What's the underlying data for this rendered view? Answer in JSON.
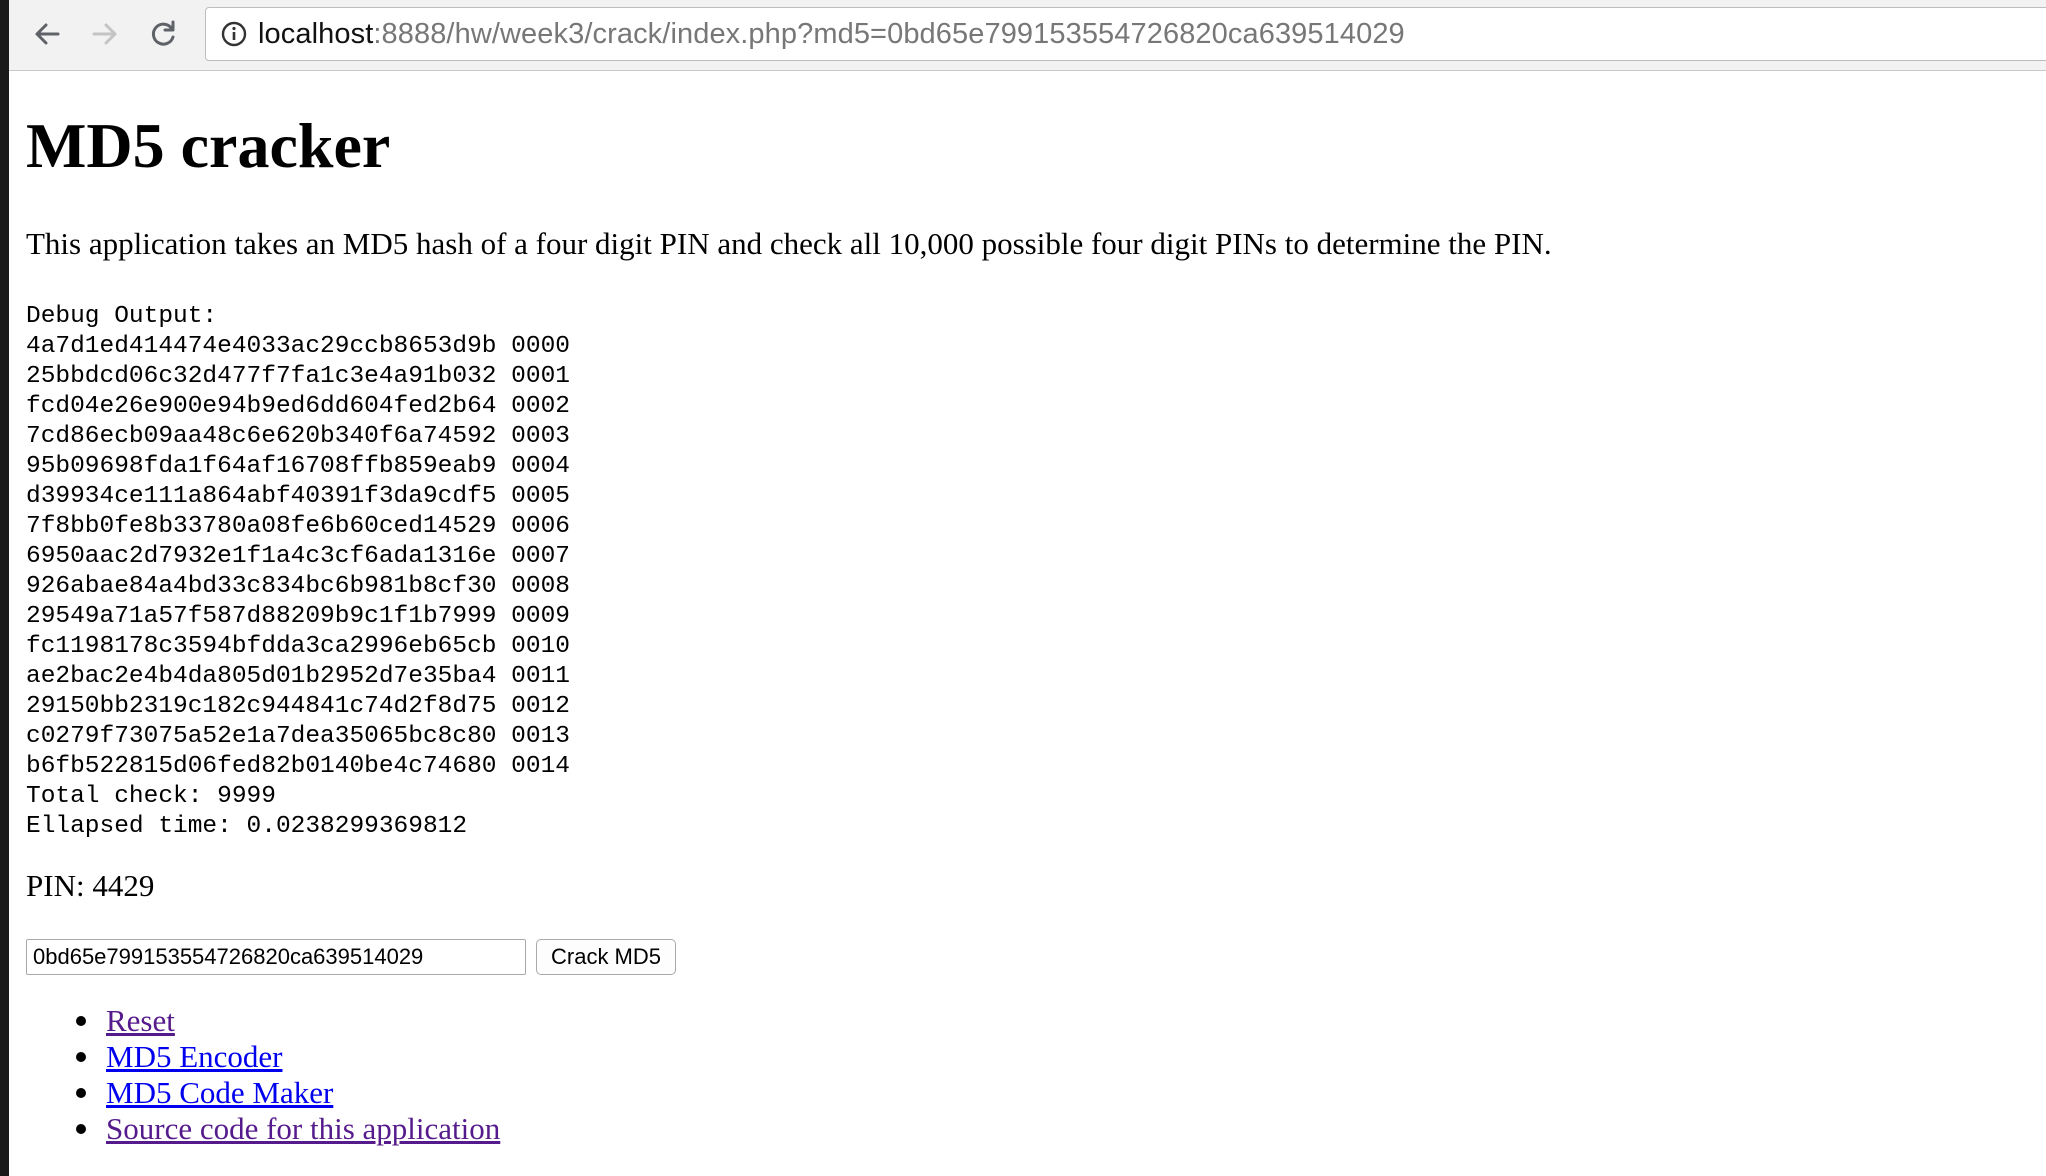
{
  "browser": {
    "url_host": "localhost",
    "url_rest": ":8888/hw/week3/crack/index.php?md5=0bd65e799153554726820ca639514029"
  },
  "page": {
    "title": "MD5 cracker",
    "description": "This application takes an MD5 hash of a four digit PIN and check all 10,000 possible four digit PINs to determine the PIN.",
    "debug_lines": [
      "Debug Output:",
      "4a7d1ed414474e4033ac29ccb8653d9b 0000",
      "25bbdcd06c32d477f7fa1c3e4a91b032 0001",
      "fcd04e26e900e94b9ed6dd604fed2b64 0002",
      "7cd86ecb09aa48c6e620b340f6a74592 0003",
      "95b09698fda1f64af16708ffb859eab9 0004",
      "d39934ce111a864abf40391f3da9cdf5 0005",
      "7f8bb0fe8b33780a08fe6b60ced14529 0006",
      "6950aac2d7932e1f1a4c3cf6ada1316e 0007",
      "926abae84a4bd33c834bc6b981b8cf30 0008",
      "29549a71a57f587d88209b9c1f1b7999 0009",
      "fc1198178c3594bfdda3ca2996eb65cb 0010",
      "ae2bac2e4b4da805d01b2952d7e35ba4 0011",
      "29150bb2319c182c944841c74d2f8d75 0012",
      "c0279f73075a52e1a7dea35065bc8c80 0013",
      "b6fb522815d06fed82b0140be4c74680 0014",
      "Total check: 9999",
      "Ellapsed time: 0.0238299369812"
    ],
    "pin_label": "PIN: ",
    "pin_value": "4429",
    "form": {
      "md5_value": "0bd65e799153554726820ca639514029",
      "submit_label": "Crack MD5"
    },
    "links": [
      {
        "label": "Reset",
        "visited": true
      },
      {
        "label": "MD5 Encoder",
        "visited": false
      },
      {
        "label": "MD5 Code Maker",
        "visited": false
      },
      {
        "label": "Source code for this application",
        "visited": true
      }
    ]
  }
}
